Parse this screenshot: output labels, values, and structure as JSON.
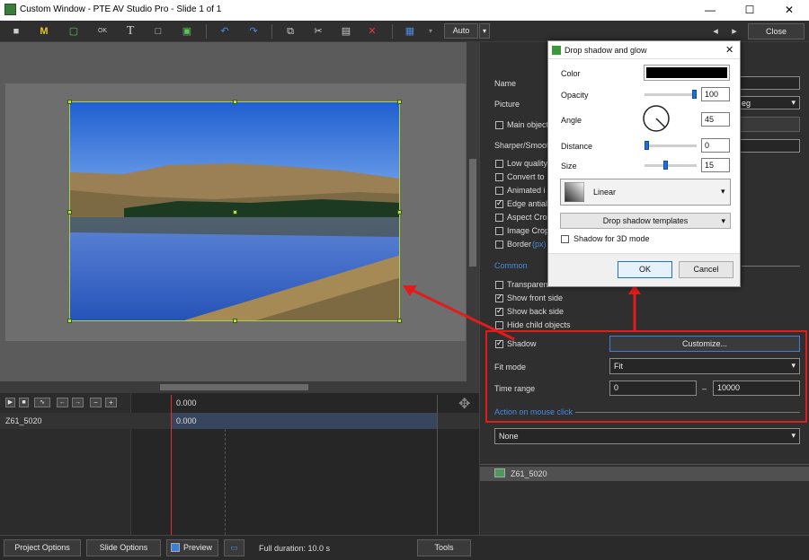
{
  "window": {
    "title": "Custom Window - PTE AV Studio Pro - Slide 1 of 1",
    "min": "—",
    "max": "☐",
    "close": "✕"
  },
  "toolbar": {
    "auto_label": "Auto",
    "close_label": "Close",
    "prev": "◂",
    "next": "▸"
  },
  "timeline": {
    "time_header": "0.000",
    "time_value": "0.000",
    "track_name": "Z61_5020"
  },
  "props": {
    "name_label": "Name",
    "picture_label": "Picture",
    "picture_value": "eg",
    "main_object": "Main object",
    "sharper": "Sharper/Smooth",
    "low_quality": "Low quality",
    "convert_to": "Convert to",
    "animated": "Animated i",
    "edge_antialias": "Edge antiali",
    "aspect_crop": "Aspect Crop",
    "image_crop": "Image Crop",
    "border": "Border",
    "border_px": "(px)",
    "common": "Common",
    "transparent": "Transparent",
    "show_front": "Show front side",
    "show_back": "Show back side",
    "hide_child": "Hide child objects",
    "shadow": "Shadow",
    "customize": "Customize...",
    "fit_mode": "Fit mode",
    "fit_value": "Fit",
    "time_range": "Time range",
    "time_from": "0",
    "time_dash": "–",
    "time_to": "10000",
    "action_header": "Action on mouse click",
    "action_value": "None",
    "tree_item": "Z61_5020"
  },
  "dialog": {
    "title": "Drop shadow and glow",
    "color": "Color",
    "opacity": "Opacity",
    "opacity_value": "100",
    "opacity_fraction": 1.0,
    "angle": "Angle",
    "angle_value": "45",
    "distance": "Distance",
    "distance_value": "0",
    "distance_fraction": 0.0,
    "size": "Size",
    "size_value": "15",
    "size_fraction": 0.4,
    "gradient": "Linear",
    "templates": "Drop shadow templates",
    "shadow3d": "Shadow for 3D mode",
    "ok": "OK",
    "cancel": "Cancel",
    "close": "✕"
  },
  "status": {
    "project_options": "Project Options",
    "slide_options": "Slide Options",
    "preview": "Preview",
    "duration": "Full duration: 10.0 s",
    "tools": "Tools"
  },
  "colors": {
    "accent": "#1e6fd6",
    "highlight": "#e21b1b",
    "selection": "#a6d44a",
    "link": "#4a8ae0"
  }
}
